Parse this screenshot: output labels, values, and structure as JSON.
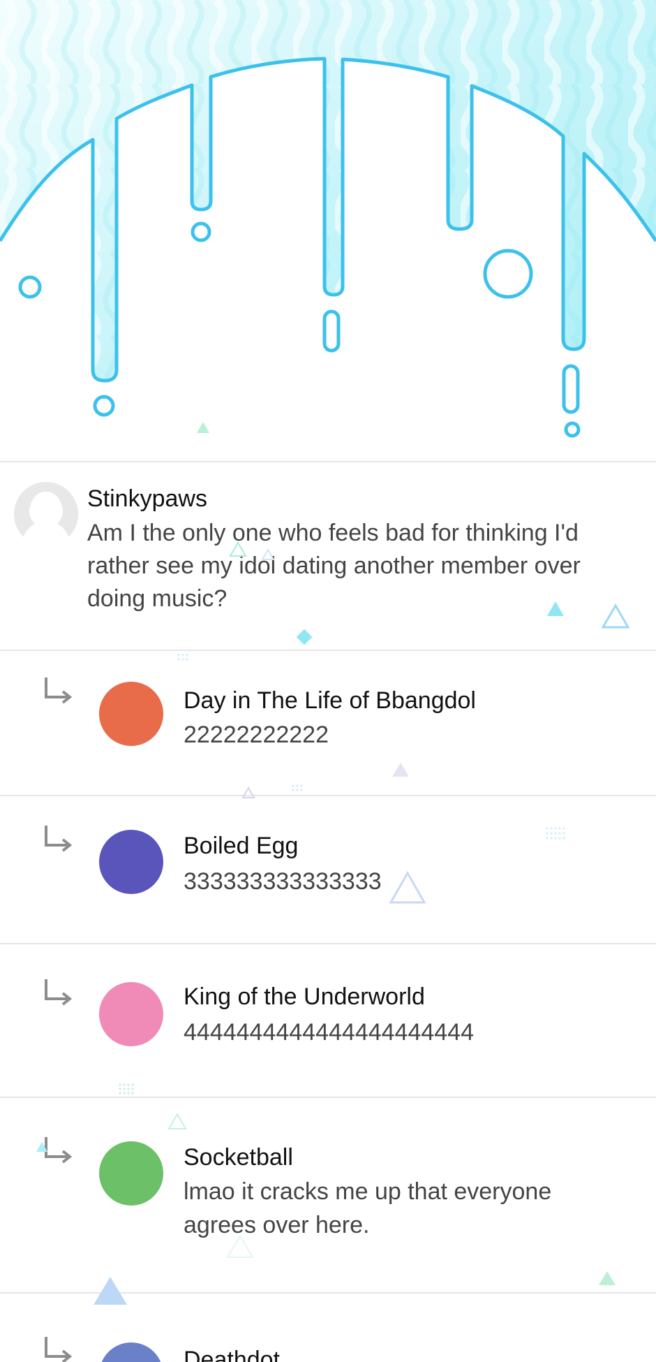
{
  "colors": {
    "accent": "#3cc1ec",
    "hero_bg_light": "#e9fbfd",
    "hero_bg_mid": "#b8f1f7",
    "divider": "#e6e6e6",
    "arrow": "#8c8c8c"
  },
  "post": {
    "author": "Stinkypaws",
    "text": "Am I the only one who feels bad for thinking I'd rather see my idol dating another member over doing music?",
    "avatar_icon": "default-user-avatar-icon"
  },
  "replies": [
    {
      "name": "Day in The Life of Bbangdol",
      "text": "22222222222",
      "avatar_color": "#e86b4a"
    },
    {
      "name": "Boiled Egg",
      "text": "333333333333333",
      "avatar_color": "#5a55bb"
    },
    {
      "name": "King of the Underworld",
      "text": "4444444444444444444444",
      "avatar_color": "#f08bb8"
    },
    {
      "name": "Socketball",
      "text": "lmao it cracks me up that everyone agrees over here.",
      "avatar_color": "#6cc067"
    },
    {
      "name": "Deathdot",
      "text": "",
      "avatar_color": "#6a80c8"
    }
  ]
}
